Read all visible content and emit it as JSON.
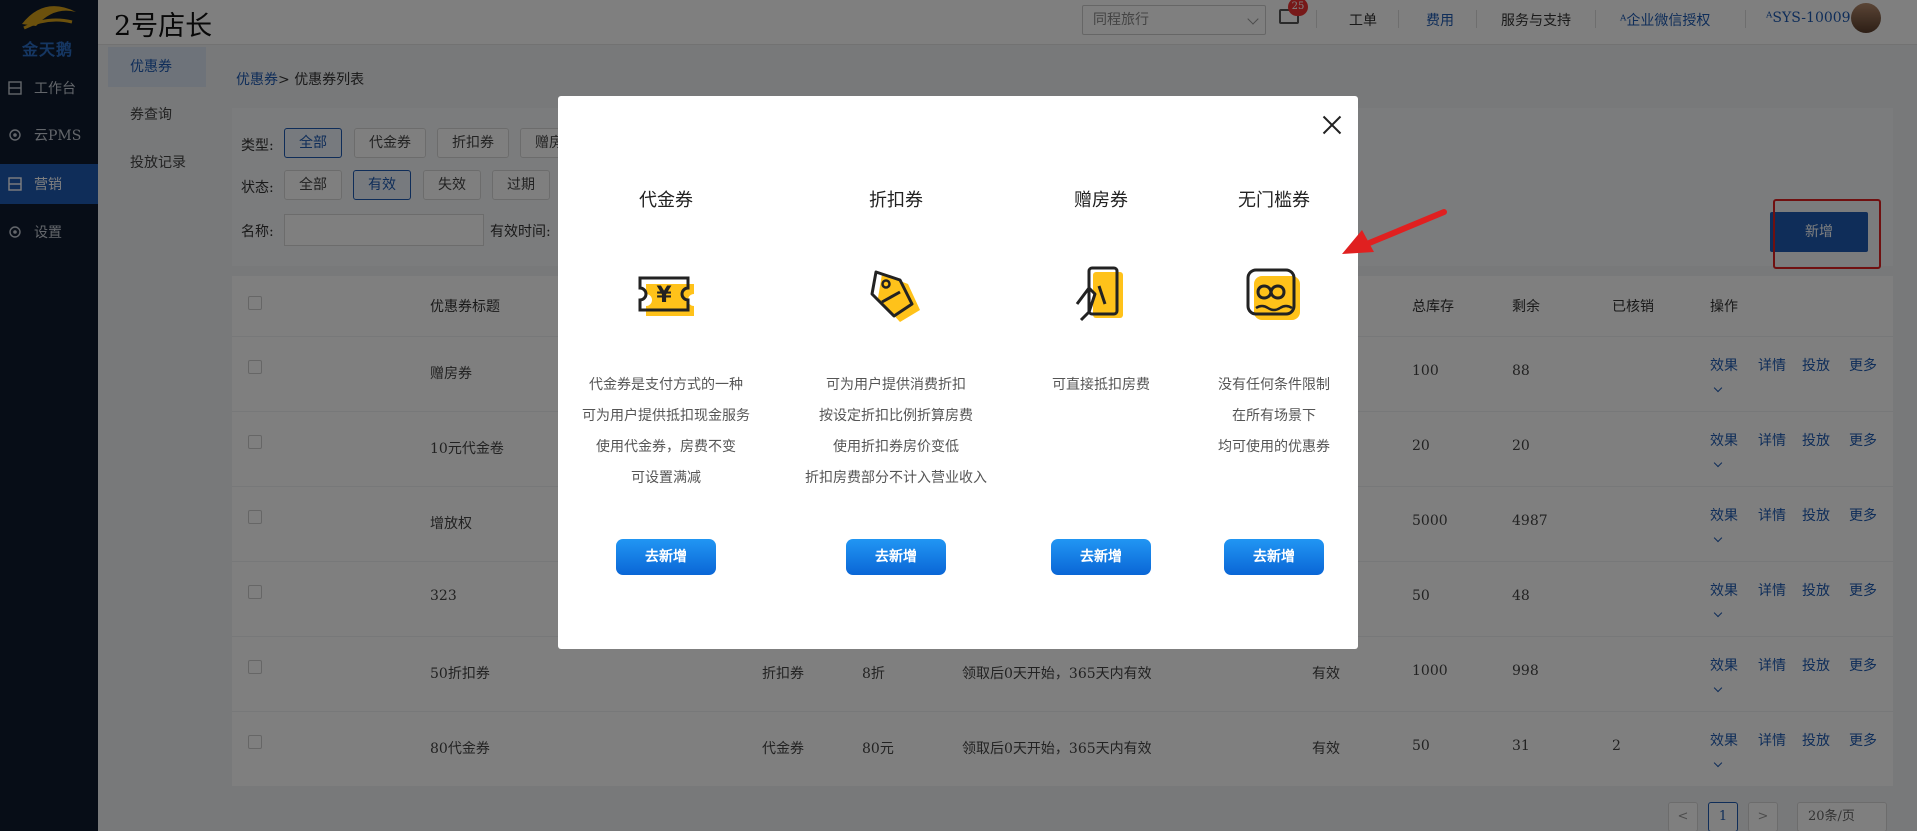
{
  "app": {
    "logo_text": "金天鹅",
    "brand": "2号店长"
  },
  "leftnav": [
    {
      "label": "工作台"
    },
    {
      "label": "云PMS"
    },
    {
      "label": "营销"
    },
    {
      "label": "设置"
    }
  ],
  "submenu": [
    {
      "label": "优惠券"
    },
    {
      "label": "券查询"
    },
    {
      "label": "投放记录"
    }
  ],
  "topbar": {
    "hotel": "同程旅行",
    "mail_count": "25",
    "links": [
      "工单",
      "费用",
      "服务与支持",
      "企业微信授权",
      "SYS-10009"
    ]
  },
  "breadcrumb": {
    "link": "优惠券",
    "sep": ">",
    "current": "优惠券列表"
  },
  "filters": {
    "type_label": "类型:",
    "types": [
      "全部",
      "代金券",
      "折扣券",
      "赠房"
    ],
    "status_label": "状态:",
    "statuses": [
      "全部",
      "有效",
      "失效",
      "过期"
    ],
    "name_label": "名称:",
    "time_label": "有效时间:",
    "add_button": "新增"
  },
  "table": {
    "headers": [
      "优惠券标题",
      "总库存",
      "剩余",
      "已核销",
      "操作"
    ],
    "ops": [
      "效果",
      "详情",
      "投放",
      "更多"
    ],
    "rows": [
      {
        "title": "赠房券",
        "type": "",
        "value": "",
        "rule": "",
        "status": "",
        "total": "100",
        "remain": "88",
        "used": ""
      },
      {
        "title": "10元代金卷",
        "type": "",
        "value": "",
        "rule": "",
        "status": "",
        "total": "20",
        "remain": "20",
        "used": ""
      },
      {
        "title": "增放权",
        "type": "",
        "value": "",
        "rule": "",
        "status": "",
        "total": "5000",
        "remain": "4987",
        "used": ""
      },
      {
        "title": "323",
        "type": "",
        "value": "",
        "rule": "",
        "status": "",
        "total": "50",
        "remain": "48",
        "used": ""
      },
      {
        "title": "50折扣券",
        "type": "折扣券",
        "value": "8折",
        "rule": "领取后0天开始，365天内有效",
        "status": "有效",
        "total": "1000",
        "remain": "998",
        "used": ""
      },
      {
        "title": "80代金券",
        "type": "代金券",
        "value": "80元",
        "rule": "领取后0天开始，365天内有效",
        "status": "有效",
        "total": "50",
        "remain": "31",
        "used": "2"
      }
    ]
  },
  "pager": {
    "prev": "<",
    "page": "1",
    "next": ">",
    "size": "20条/页"
  },
  "modal": {
    "columns": [
      {
        "title": "代金券",
        "icon": "cash-voucher-icon",
        "desc": [
          "代金券是支付方式的一种",
          "可为用户提供抵扣现金服务",
          "使用代金券，房费不变",
          "可设置满减"
        ],
        "button": "去新增"
      },
      {
        "title": "折扣券",
        "icon": "discount-tag-icon",
        "desc": [
          "可为用户提供消费折扣",
          "按设定折扣比例折算房费",
          "使用折扣券房价变低",
          "折扣房费部分不计入营业收入"
        ],
        "button": "去新增"
      },
      {
        "title": "赠房券",
        "icon": "room-gift-icon",
        "desc": [
          "可直接抵扣房费"
        ],
        "button": "去新增"
      },
      {
        "title": "无门槛券",
        "icon": "infinity-coupon-icon",
        "desc": [
          "没有任何条件限制",
          "在所有场景下",
          "均可使用的优惠券"
        ],
        "button": "去新增"
      }
    ]
  },
  "colors": {
    "primary": "#1e5bb3",
    "accent_yellow": "#ffc21a",
    "highlight_red": "#e02020"
  }
}
